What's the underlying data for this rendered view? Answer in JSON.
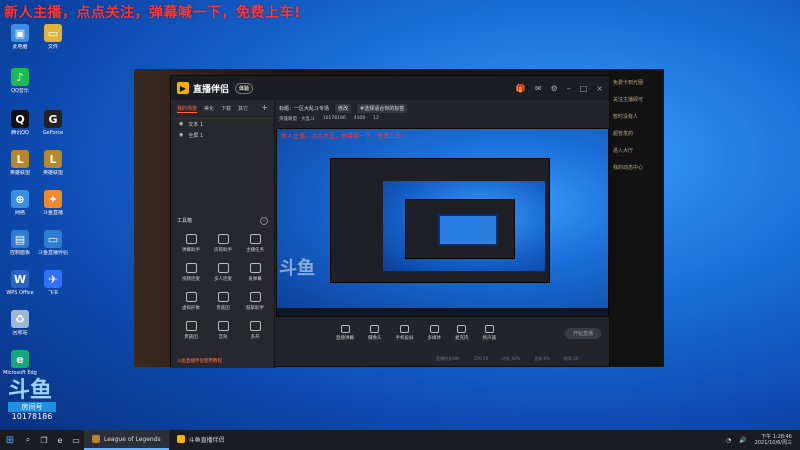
{
  "overlay_banner": "新人主播，点点关注，弹幕喊一下，免费上车!",
  "desktop_icons": [
    {
      "label": "此电脑",
      "glyph": "▣",
      "color": "#3c8fe0"
    },
    {
      "label": "QQ音乐",
      "glyph": "♪",
      "color": "#1db954"
    },
    {
      "label": "腾讯QQ",
      "glyph": "Q",
      "color": "#111111"
    },
    {
      "label": "英雄联盟",
      "glyph": "L",
      "color": "#b8862b"
    },
    {
      "label": "网络",
      "glyph": "⊕",
      "color": "#3c8fe0"
    },
    {
      "label": "控制面板",
      "glyph": "▤",
      "color": "#2e7bd1"
    },
    {
      "label": "WPS Office",
      "glyph": "W",
      "color": "#2a63c8"
    },
    {
      "label": "回收站",
      "glyph": "♻",
      "color": "#9bb7d6"
    },
    {
      "label": "Microsoft Edge",
      "glyph": "e",
      "color": "#19a67a"
    },
    {
      "label": "文件",
      "glyph": "▭",
      "color": "#e0b33a"
    },
    {
      "label": "GeForce",
      "glyph": "G",
      "color": "#222222"
    },
    {
      "label": "英雄联盟",
      "glyph": "L",
      "color": "#b8862b"
    },
    {
      "label": "斗鱼直播",
      "glyph": "✦",
      "color": "#f08a2e"
    },
    {
      "label": "斗鱼直播伴侣",
      "glyph": "▭",
      "color": "#2e7bd1"
    },
    {
      "label": "飞书",
      "glyph": "✈",
      "color": "#3370ff"
    }
  ],
  "app": {
    "title": "直播伴侣",
    "version_pill": "体验",
    "tabs": [
      "我的场景",
      "美化",
      "下载",
      "其它"
    ],
    "scenes": [
      "文本 1",
      "全屏 1"
    ],
    "tools_header": "工具箱",
    "tools": [
      "弹幕助手",
      "房管助手",
      "主播任务",
      "视频连麦",
      "多人连麦",
      "发弹幕",
      "虚拟形象",
      "贵族团",
      "鼓掌助手",
      "贵族团",
      "音效",
      "多开"
    ],
    "footnote": "斗鱼直播伴侣使用教程",
    "room_title": "标题：一区大乱斗专场",
    "edit_label": "修改",
    "category": "#选择适合你的标签",
    "game": "英雄联盟 · 大乱斗",
    "room_id": "10178186",
    "followers": "4108",
    "online": "12",
    "controls": [
      "直播弹幕",
      "摄像头",
      "手机投屏",
      "多媒体",
      "麦克风",
      "扬声器"
    ],
    "start_button": "开始直播",
    "status": [
      "直播时长00h",
      "CPU 20",
      "内存 40%",
      "丢帧 0%",
      "帧率 30"
    ]
  },
  "right_panel": [
    "免费卡到光圈",
    "关注主播即可",
    "暂时没有人",
    "超管发的",
    "进入大厅",
    "我的动态中心"
  ],
  "watermark": {
    "logo": "斗鱼",
    "badge": "房间号",
    "number": "10178186"
  },
  "taskbar": {
    "apps": [
      {
        "label": "League of Legends",
        "color": "#b8862b"
      },
      {
        "label": "斗鱼直播伴侣",
        "color": "#f5b300"
      }
    ],
    "time": "下午 1:28:46",
    "date": "2021/10/6/周三"
  }
}
